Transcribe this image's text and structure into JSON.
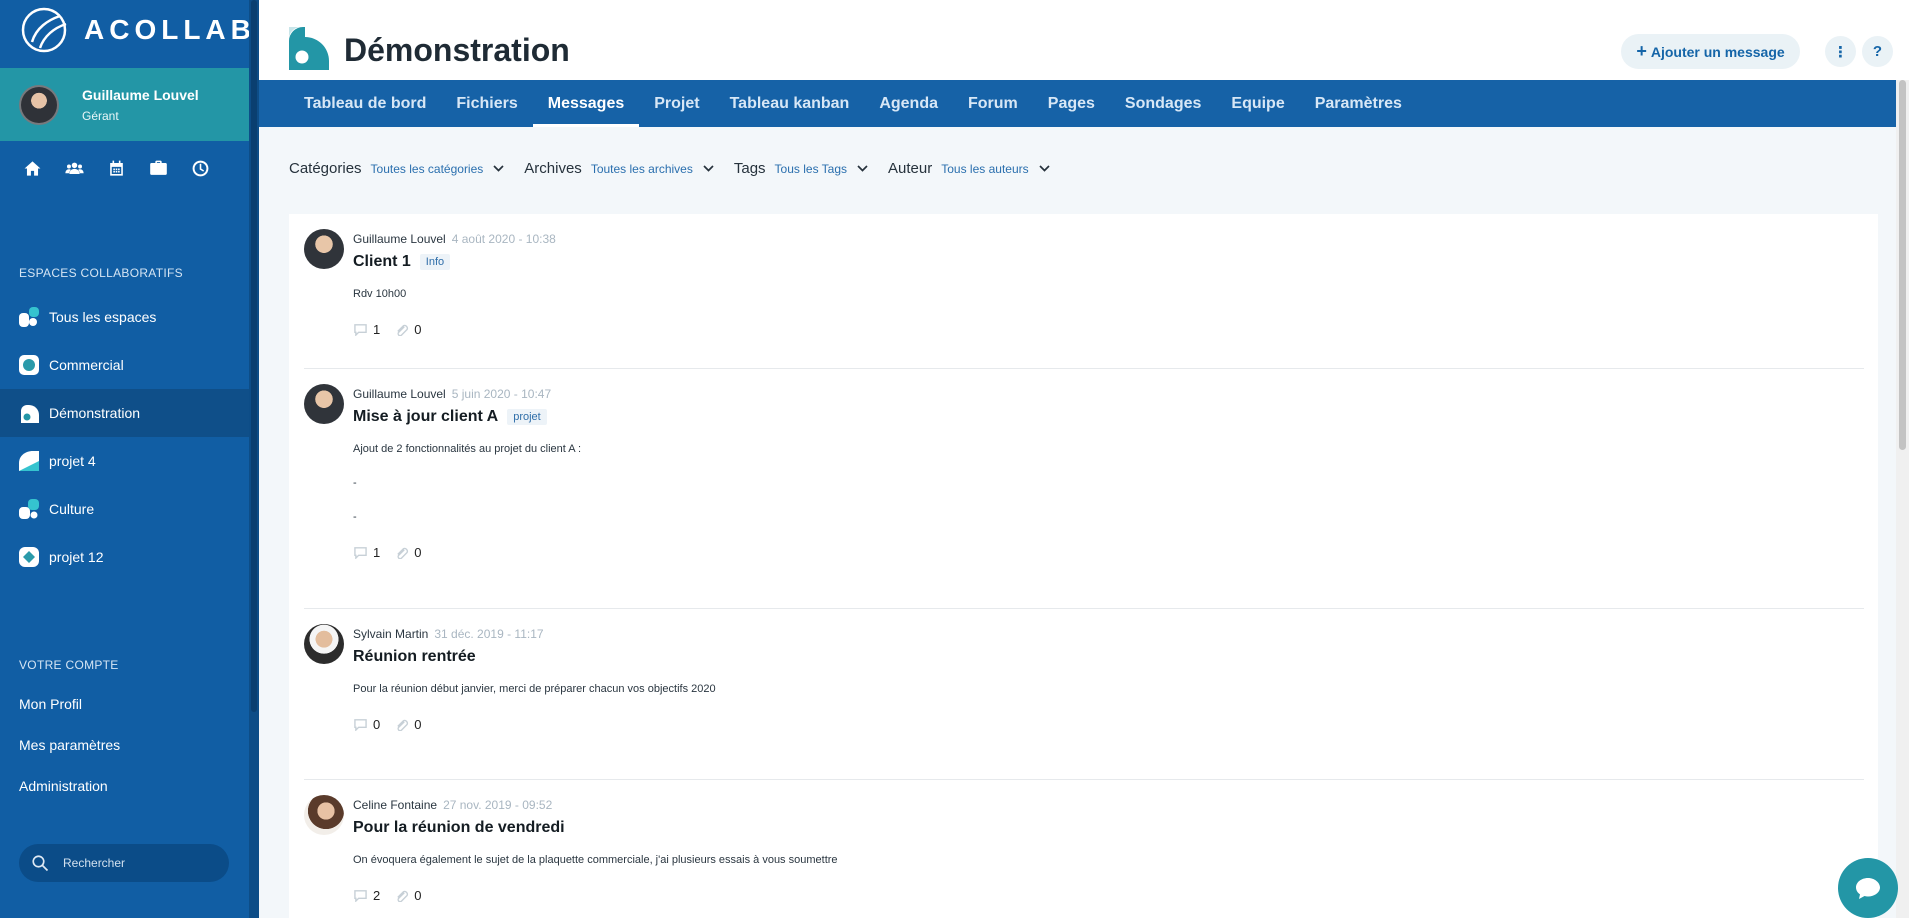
{
  "brand": {
    "name": "ACOLLAB"
  },
  "user": {
    "name": "Guillaume Louvel",
    "role": "Gérant"
  },
  "quick_icons": [
    "home-icon",
    "users-icon",
    "calendar-icon",
    "briefcase-icon",
    "clock-icon"
  ],
  "sidebar": {
    "spaces_title": "ESPACES COLLABORATIFS",
    "spaces": [
      {
        "label": "Tous les espaces"
      },
      {
        "label": "Commercial"
      },
      {
        "label": "Démonstration",
        "active": true
      },
      {
        "label": "projet 4"
      },
      {
        "label": "Culture"
      },
      {
        "label": "projet 12"
      }
    ],
    "account_title": "VOTRE COMPTE",
    "account_links": [
      "Mon Profil",
      "Mes paramètres",
      "Administration"
    ],
    "search_placeholder": "Rechercher"
  },
  "header": {
    "title": "Démonstration",
    "add_button": "Ajouter un message",
    "more_button": "⋮",
    "help_button": "?"
  },
  "tabs": [
    {
      "label": "Tableau de bord"
    },
    {
      "label": "Fichiers"
    },
    {
      "label": "Messages",
      "active": true
    },
    {
      "label": "Projet"
    },
    {
      "label": "Tableau kanban"
    },
    {
      "label": "Agenda"
    },
    {
      "label": "Forum"
    },
    {
      "label": "Pages"
    },
    {
      "label": "Sondages"
    },
    {
      "label": "Equipe"
    },
    {
      "label": "Paramètres"
    }
  ],
  "filters": [
    {
      "label": "Catégories",
      "value": "Toutes les catégories"
    },
    {
      "label": "Archives",
      "value": "Toutes les archives"
    },
    {
      "label": "Tags",
      "value": "Tous les Tags"
    },
    {
      "label": "Auteur",
      "value": "Tous les auteurs"
    }
  ],
  "messages": [
    {
      "author": "Guillaume Louvel",
      "date": "4 août 2020 - 10:38",
      "title": "Client 1",
      "tag": "Info",
      "lines": [
        "Rdv 10h00"
      ],
      "comments": "1",
      "attachments": "0"
    },
    {
      "author": "Guillaume Louvel",
      "date": "5 juin 2020 - 10:47",
      "title": "Mise à jour client A",
      "tag": "projet",
      "lines": [
        "Ajout de 2 fonctionnalités au projet du client A :",
        "-",
        "-"
      ],
      "comments": "1",
      "attachments": "0"
    },
    {
      "author": "Sylvain Martin",
      "date": "31 déc. 2019 - 11:17",
      "title": "Réunion rentrée",
      "tag": "",
      "lines": [
        "Pour la réunion début janvier, merci de préparer chacun vos objectifs 2020"
      ],
      "comments": "0",
      "attachments": "0"
    },
    {
      "author": "Celine Fontaine",
      "date": "27 nov. 2019 - 09:52",
      "title": "Pour la réunion de vendredi",
      "tag": "",
      "lines": [
        "On évoquera également le sujet de la plaquette commerciale, j'ai plusieurs essais à vous soumettre"
      ],
      "comments": "2",
      "attachments": "0"
    }
  ],
  "colors": {
    "sidebar": "#115ea4",
    "user_block": "#2396a6",
    "tabs_bar": "#1662a7",
    "accent": "#2396a6"
  }
}
